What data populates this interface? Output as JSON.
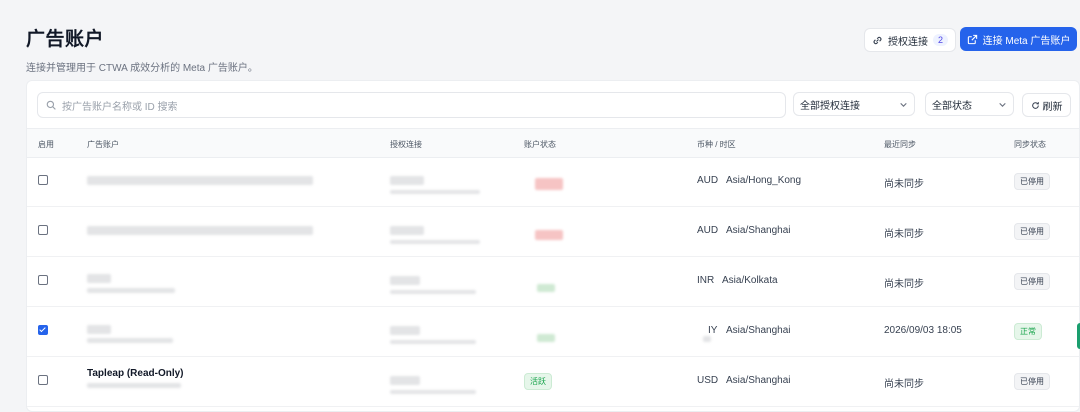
{
  "header": {
    "title": "广告账户",
    "subtitle": "连接并管理用于 CTWA 成效分析的 Meta 广告账户。"
  },
  "actions": {
    "auth_label": "授权连接",
    "auth_count": "2",
    "connect_label": "连接 Meta 广告账户"
  },
  "toolbar": {
    "search_placeholder": "按广告账户名称或 ID 搜索",
    "auth_filter": "全部授权连接",
    "status_filter": "全部状态",
    "refresh_label": "刷新"
  },
  "table": {
    "columns": {
      "enabled": "启用",
      "account": "广告账户",
      "auth": "授权连接",
      "status": "账户状态",
      "currency": "币种 / 时区",
      "last_sync": "最近同步",
      "sync_status": "同步状态"
    },
    "rows": [
      {
        "checked": false,
        "currency": "AUD",
        "timezone": "Asia/Hong_Kong",
        "last_sync": "尚未同步",
        "sync_status": "已停用"
      },
      {
        "checked": false,
        "currency": "AUD",
        "timezone": "Asia/Shanghai",
        "last_sync": "尚未同步",
        "sync_status": "已停用"
      },
      {
        "checked": false,
        "currency": "INR",
        "timezone": "Asia/Kolkata",
        "last_sync": "尚未同步",
        "sync_status": "已停用"
      },
      {
        "checked": true,
        "currency": "IY",
        "timezone": "Asia/Shanghai",
        "last_sync": "2026/09/03 18:05",
        "sync_status": "正常"
      },
      {
        "checked": false,
        "name": "Tapleap (Read-Only)",
        "account_status": "活跃",
        "currency": "USD",
        "timezone": "Asia/Shanghai",
        "last_sync": "尚未同步",
        "sync_status": "已停用"
      }
    ]
  },
  "icons": {
    "link": "link-icon",
    "external": "external-link-icon",
    "search": "search-icon",
    "chevron": "chevron-down-icon",
    "refresh": "refresh-icon"
  },
  "colors": {
    "primary": "#2563eb",
    "success": "#16a34a"
  }
}
